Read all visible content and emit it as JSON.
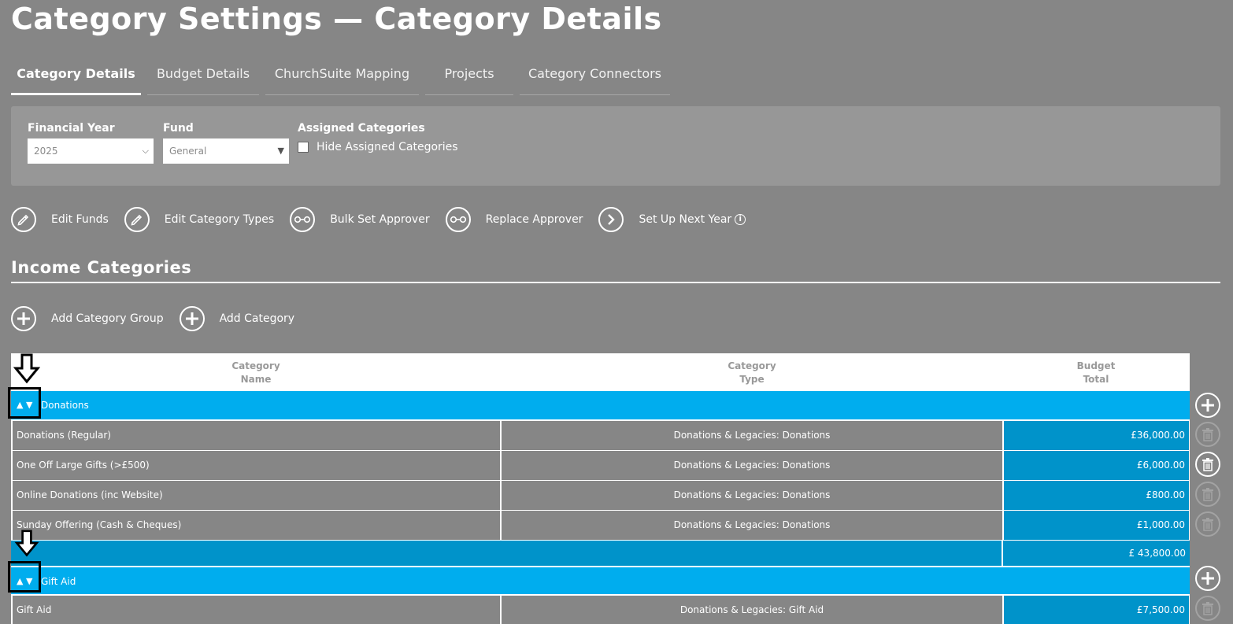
{
  "page": {
    "title": "Category Settings — Category Details"
  },
  "tabs": [
    {
      "label": "Category Details",
      "active": true
    },
    {
      "label": "Budget Details"
    },
    {
      "label": "ChurchSuite Mapping"
    },
    {
      "label": "Projects"
    },
    {
      "label": "Category Connectors"
    }
  ],
  "filters": {
    "financial_year": {
      "label": "Financial Year",
      "value": "2025"
    },
    "fund": {
      "label": "Fund",
      "value": "General"
    },
    "assigned": {
      "label": "Assigned Categories",
      "checkbox_label": "Hide Assigned Categories",
      "checked": false
    }
  },
  "actions": [
    {
      "label": "Edit Funds",
      "icon": "pencil-icon"
    },
    {
      "label": "Edit Category Types",
      "icon": "pencil-icon"
    },
    {
      "label": "Bulk Set Approver",
      "icon": "key-icon"
    },
    {
      "label": "Replace Approver",
      "icon": "key-icon"
    },
    {
      "label": "Set Up Next Year",
      "icon": "chevron-right-icon"
    }
  ],
  "section": {
    "title": "Income Categories"
  },
  "add_actions": [
    {
      "label": "Add Category Group",
      "icon": "plus-icon"
    },
    {
      "label": "Add Category",
      "icon": "plus-icon"
    }
  ],
  "table": {
    "headers": {
      "name": [
        "Category",
        "Name"
      ],
      "type": [
        "Category",
        "Type"
      ],
      "budget": [
        "Budget",
        "Total"
      ]
    },
    "groups": [
      {
        "arrows": "▲ ▼",
        "name": "Donations",
        "rows": [
          {
            "name": "Donations (Regular)",
            "type": "Donations & Legacies: Donations",
            "budget": "£36,000.00"
          },
          {
            "name": "One Off Large Gifts (>£500)",
            "type": "Donations & Legacies: Donations",
            "budget": "£6,000.00"
          },
          {
            "name": "Online Donations (inc Website)",
            "type": "Donations & Legacies: Donations",
            "budget": "£800.00"
          },
          {
            "name": "Sunday Offering (Cash & Cheques)",
            "type": "Donations & Legacies: Donations",
            "budget": "£1,000.00"
          }
        ],
        "total": "£ 43,800.00"
      },
      {
        "arrows": "▲ ▼",
        "name": "Gift Aid",
        "rows": [
          {
            "name": "Gift Aid",
            "type": "Donations & Legacies: Gift Aid",
            "budget": "£7,500.00"
          }
        ]
      }
    ]
  },
  "colors": {
    "background": "#868686",
    "panel": "#979797",
    "group_row": "#00adee",
    "budget_cell": "#0093ca",
    "marker": "#000000"
  }
}
